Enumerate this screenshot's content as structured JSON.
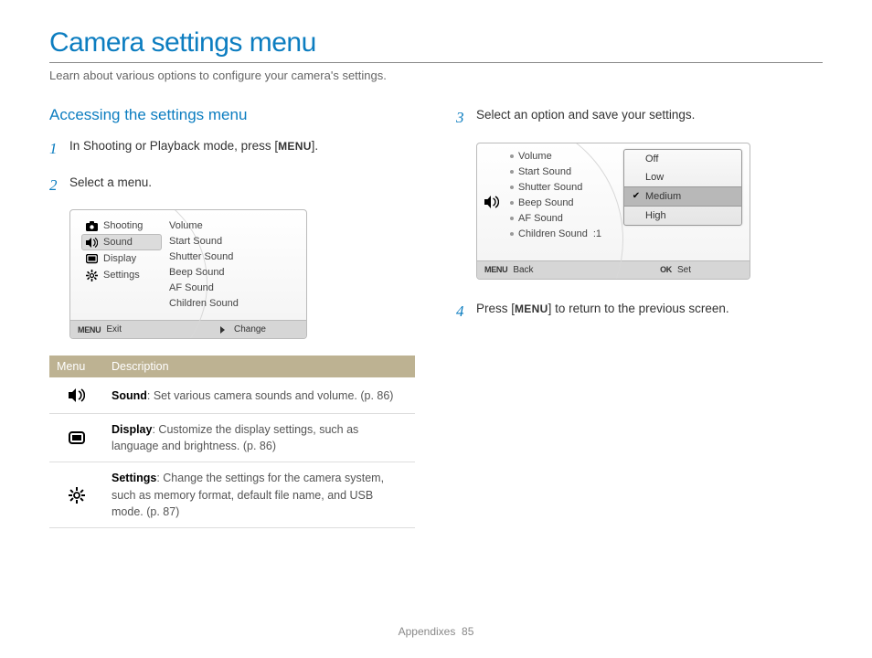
{
  "header": {
    "title": "Camera settings menu",
    "intro": "Learn about various options to configure your camera's settings."
  },
  "left": {
    "section_title": "Accessing the settings menu",
    "step1_a": "In Shooting or Playback mode, press [",
    "step1_btn": "MENU",
    "step1_b": "].",
    "step2": "Select a menu.",
    "lcd1": {
      "left": {
        "shooting": "Shooting",
        "sound": "Sound",
        "display": "Display",
        "settings": "Settings"
      },
      "right": {
        "volume": "Volume",
        "start": "Start Sound",
        "shutter": "Shutter Sound",
        "beep": "Beep Sound",
        "af": "AF Sound",
        "children": "Children Sound"
      },
      "footer": {
        "menu": "MENU",
        "exit": "Exit",
        "change": "Change"
      }
    },
    "table": {
      "h1": "Menu",
      "h2": "Description",
      "r1_b": "Sound",
      "r1": ": Set various camera sounds and volume. (p. 86)",
      "r2_b": "Display",
      "r2": ": Customize the display settings, such as language and brightness. (p. 86)",
      "r3_b": "Settings",
      "r3": ": Change the settings for the camera system, such as memory format, default file name, and USB mode. (p. 87)"
    }
  },
  "right": {
    "step3": "Select an option and save your settings.",
    "lcd2": {
      "list": {
        "volume": "Volume",
        "start": "Start Sound",
        "shutter": "Shutter Sound",
        "beep": "Beep Sound",
        "af": "AF Sound",
        "children": "Children Sound",
        "children_val": ":1"
      },
      "popup": {
        "off": "Off",
        "low": "Low",
        "medium": "Medium",
        "high": "High"
      },
      "footer": {
        "menu": "MENU",
        "back": "Back",
        "ok": "OK",
        "set": "Set"
      }
    },
    "step4_a": "Press [",
    "step4_btn": "MENU",
    "step4_b": "] to return to the previous screen."
  },
  "footer": {
    "section": "Appendixes",
    "page": "85"
  },
  "nums": {
    "n1": "1",
    "n2": "2",
    "n3": "3",
    "n4": "4"
  }
}
